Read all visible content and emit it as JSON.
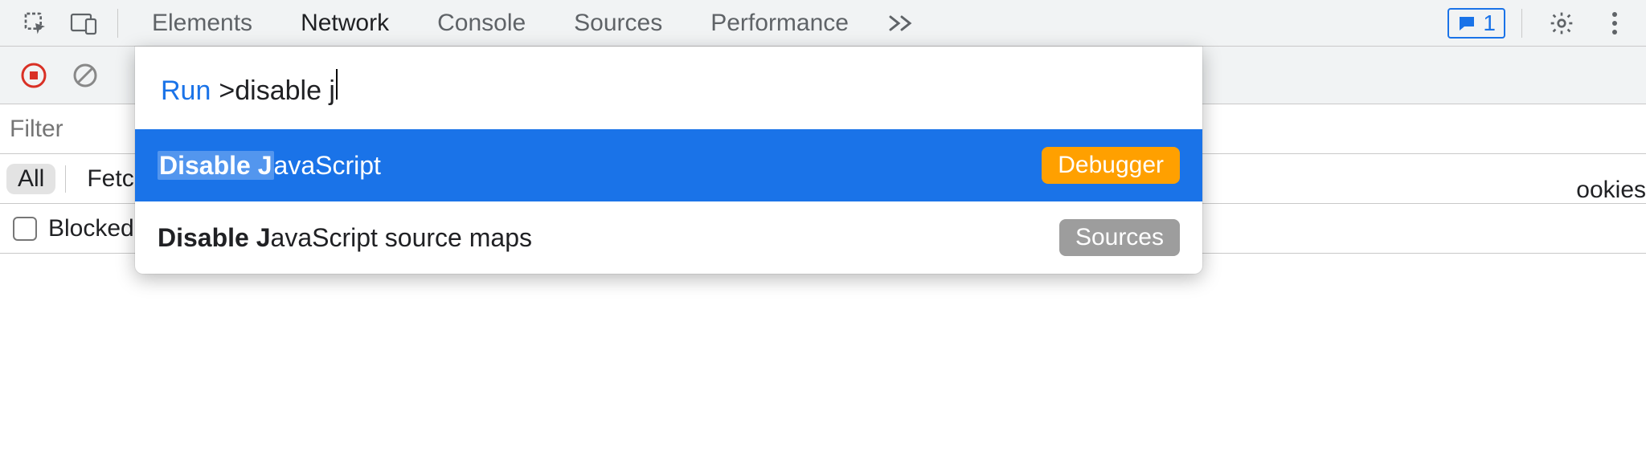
{
  "tabs": {
    "elements": "Elements",
    "network": "Network",
    "console": "Console",
    "sources": "Sources",
    "performance": "Performance"
  },
  "issues": {
    "count": "1"
  },
  "filter": {
    "placeholder": "Filter"
  },
  "chips": {
    "all": "All",
    "fetch": "Fetch/"
  },
  "blocked": {
    "label": "Blocked"
  },
  "cookies": {
    "label": "ookies"
  },
  "cmd": {
    "prefix": "Run",
    "gt": ">",
    "query": "disable j",
    "item1_bold": "Disable J",
    "item1_rest": "avaScript",
    "item1_badge": "Debugger",
    "item2_bold": "Disable J",
    "item2_rest": "avaScript source maps",
    "item2_badge": "Sources"
  }
}
